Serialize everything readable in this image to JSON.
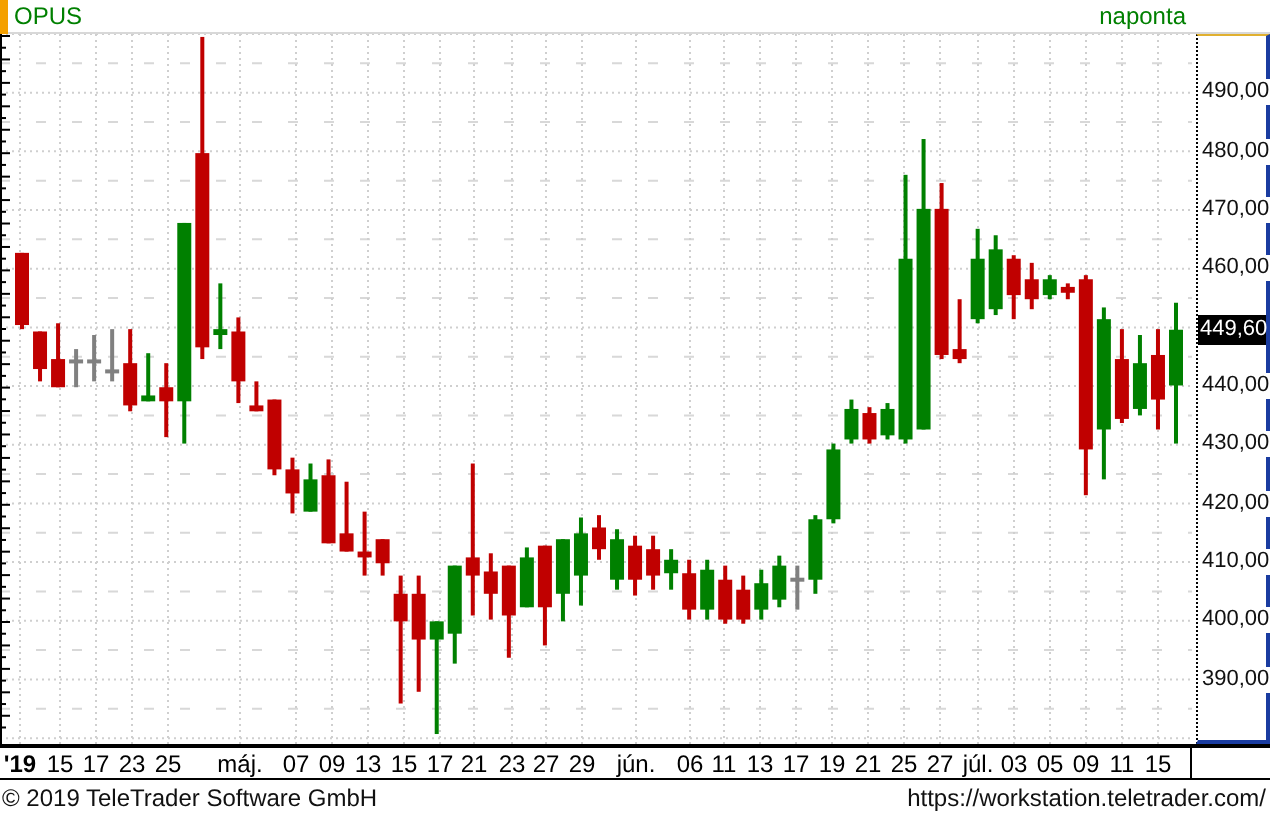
{
  "header": {
    "symbol": "OPUS",
    "interval": "naponta"
  },
  "chart_data": {
    "type": "candlestick",
    "ylim": [
      379,
      500
    ],
    "yticks": [
      {
        "value": 490,
        "label": "490,00"
      },
      {
        "value": 480,
        "label": "480,00"
      },
      {
        "value": 470,
        "label": "470,00"
      },
      {
        "value": 460,
        "label": "460,00"
      },
      {
        "value": 440,
        "label": "440,00"
      },
      {
        "value": 430,
        "label": "430,00"
      },
      {
        "value": 420,
        "label": "420,00"
      },
      {
        "value": 410,
        "label": "410,00"
      },
      {
        "value": 400,
        "label": "400,00"
      },
      {
        "value": 390,
        "label": "390,00"
      }
    ],
    "ohlc": [
      [
        462.7,
        462.7,
        449.7,
        450.4
      ],
      [
        449.3,
        449.3,
        440.8,
        442.9
      ],
      [
        444.6,
        450.7,
        439.8,
        439.8
      ],
      [
        444.2,
        446.3,
        439.8,
        444.2
      ],
      [
        444.2,
        448.7,
        440.8,
        444.2
      ],
      [
        442.5,
        449.7,
        440.8,
        442.5
      ],
      [
        443.9,
        449.7,
        435.7,
        436.7
      ],
      [
        437.4,
        445.6,
        437.4,
        438.4
      ],
      [
        439.8,
        443.9,
        431.3,
        437.4
      ],
      [
        437.4,
        467.8,
        430.2,
        467.8
      ],
      [
        479.7,
        499.5,
        444.6,
        446.6
      ],
      [
        448.7,
        457.5,
        446.3,
        449.7
      ],
      [
        449.3,
        451.7,
        437.1,
        440.8
      ],
      [
        436.7,
        440.8,
        435.7,
        435.7
      ],
      [
        437.7,
        437.7,
        424.8,
        425.8
      ],
      [
        425.8,
        427.8,
        418.3,
        421.7
      ],
      [
        418.6,
        426.8,
        418.6,
        424.1
      ],
      [
        424.8,
        427.5,
        413.2,
        413.2
      ],
      [
        414.9,
        423.7,
        411.8,
        411.8
      ],
      [
        411.8,
        418.6,
        407.7,
        410.8
      ],
      [
        413.9,
        413.9,
        407.7,
        409.8
      ],
      [
        404.6,
        407.7,
        385.9,
        399.9
      ],
      [
        404.6,
        407.7,
        387.9,
        396.8
      ],
      [
        396.8,
        399.9,
        380.7,
        399.9
      ],
      [
        397.8,
        409.4,
        392.7,
        409.4
      ],
      [
        410.8,
        426.8,
        400.9,
        407.7
      ],
      [
        408.4,
        411.5,
        400.2,
        404.6
      ],
      [
        409.4,
        409.4,
        393.7,
        400.9
      ],
      [
        402.3,
        412.5,
        402.3,
        410.8
      ],
      [
        412.8,
        412.8,
        395.8,
        402.3
      ],
      [
        404.6,
        413.9,
        399.9,
        413.9
      ],
      [
        407.7,
        417.6,
        402.6,
        414.9
      ],
      [
        415.9,
        418.0,
        410.4,
        412.2
      ],
      [
        407.0,
        415.6,
        405.3,
        413.9
      ],
      [
        412.8,
        414.5,
        404.3,
        407.0
      ],
      [
        412.2,
        414.5,
        405.3,
        407.7
      ],
      [
        408.1,
        412.2,
        405.3,
        410.4
      ],
      [
        408.1,
        410.4,
        400.2,
        401.9
      ],
      [
        401.9,
        410.4,
        400.2,
        408.7
      ],
      [
        407.0,
        409.4,
        399.5,
        400.2
      ],
      [
        405.3,
        407.7,
        399.5,
        400.2
      ],
      [
        401.9,
        408.7,
        400.2,
        406.4
      ],
      [
        403.6,
        411.1,
        402.3,
        409.4
      ],
      [
        407.0,
        409.4,
        401.9,
        407.0
      ],
      [
        407.0,
        418.0,
        404.6,
        417.3
      ],
      [
        417.3,
        430.2,
        416.6,
        429.2
      ],
      [
        430.9,
        437.7,
        430.2,
        436.1
      ],
      [
        435.4,
        436.4,
        430.2,
        430.9
      ],
      [
        431.6,
        437.1,
        430.9,
        436.1
      ],
      [
        430.9,
        476.0,
        430.2,
        461.7
      ],
      [
        432.6,
        482.1,
        432.6,
        470.2
      ],
      [
        470.2,
        474.6,
        444.6,
        445.3
      ],
      [
        446.3,
        454.8,
        443.9,
        444.6
      ],
      [
        451.4,
        466.8,
        450.7,
        461.7
      ],
      [
        453.1,
        465.7,
        452.1,
        463.3
      ],
      [
        461.7,
        462.3,
        451.4,
        455.5
      ],
      [
        458.2,
        461.0,
        453.1,
        454.8
      ],
      [
        455.5,
        458.9,
        454.8,
        458.2
      ],
      [
        456.9,
        457.5,
        454.8,
        455.9
      ],
      [
        458.2,
        458.9,
        421.4,
        429.2
      ],
      [
        432.6,
        453.4,
        424.1,
        451.4
      ],
      [
        444.6,
        449.7,
        433.7,
        434.4
      ],
      [
        436.1,
        448.7,
        435.0,
        443.9
      ],
      [
        445.3,
        449.7,
        432.6,
        437.7
      ],
      [
        440.1,
        454.2,
        430.2,
        449.6
      ]
    ],
    "grid": true
  },
  "price_axis": {
    "last_price": "449,60"
  },
  "date_axis": {
    "labels": [
      {
        "text": "'19",
        "kind": "year"
      },
      {
        "text": "15",
        "kind": "day"
      },
      {
        "text": "17",
        "kind": "day"
      },
      {
        "text": "23",
        "kind": "day"
      },
      {
        "text": "25",
        "kind": "day"
      },
      {
        "text": "máj.",
        "kind": "month"
      },
      {
        "text": "07",
        "kind": "day"
      },
      {
        "text": "09",
        "kind": "day"
      },
      {
        "text": "13",
        "kind": "day"
      },
      {
        "text": "15",
        "kind": "day"
      },
      {
        "text": "17",
        "kind": "day"
      },
      {
        "text": "21",
        "kind": "day"
      },
      {
        "text": "23",
        "kind": "day"
      },
      {
        "text": "27",
        "kind": "day"
      },
      {
        "text": "29",
        "kind": "day"
      },
      {
        "text": "jún.",
        "kind": "month"
      },
      {
        "text": "06",
        "kind": "day"
      },
      {
        "text": "11",
        "kind": "day"
      },
      {
        "text": "13",
        "kind": "day"
      },
      {
        "text": "17",
        "kind": "day"
      },
      {
        "text": "19",
        "kind": "day"
      },
      {
        "text": "21",
        "kind": "day"
      },
      {
        "text": "25",
        "kind": "day"
      },
      {
        "text": "27",
        "kind": "day"
      },
      {
        "text": "júl.",
        "kind": "month"
      },
      {
        "text": "03",
        "kind": "day"
      },
      {
        "text": "05",
        "kind": "day"
      },
      {
        "text": "09",
        "kind": "day"
      },
      {
        "text": "11",
        "kind": "day"
      },
      {
        "text": "15",
        "kind": "day"
      }
    ]
  },
  "footer": {
    "copyright": "© 2019 TeleTrader Software GmbH",
    "url": "https://workstation.teletrader.com/"
  }
}
